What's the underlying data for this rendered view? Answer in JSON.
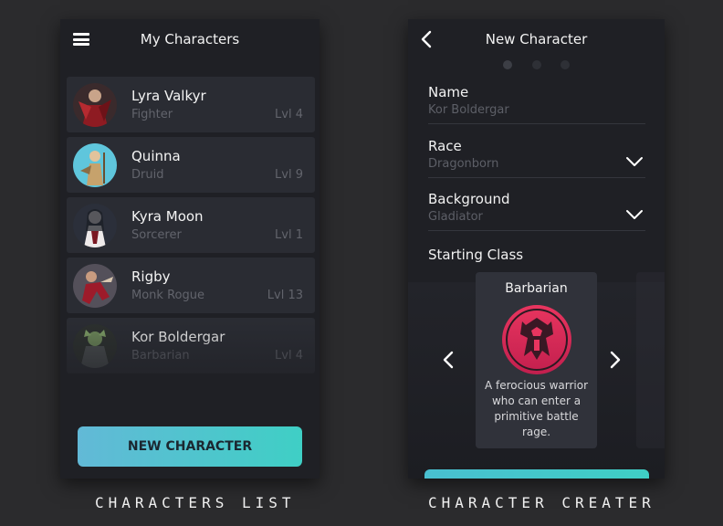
{
  "list_screen": {
    "title": "My Characters",
    "characters": [
      {
        "name": "Lyra Valkyr",
        "class": "Fighter",
        "level": "Lvl 4",
        "avatar": "portrait-warrior-red"
      },
      {
        "name": "Quinna",
        "class": "Druid",
        "level": "Lvl 9",
        "avatar": "portrait-druid-blue"
      },
      {
        "name": "Kyra Moon",
        "class": "Sorcerer",
        "level": "Lvl 1",
        "avatar": "portrait-sorcerer-dark"
      },
      {
        "name": "Rigby",
        "class": "Monk Rogue",
        "level": "Lvl 13",
        "avatar": "portrait-monk-red"
      },
      {
        "name": "Kor Boldergar",
        "class": "Barbarian",
        "level": "Lvl 4",
        "avatar": "portrait-barbarian-green"
      }
    ],
    "new_button": "NEW CHARACTER"
  },
  "create_screen": {
    "title": "New Character",
    "steps": 3,
    "current_step": 1,
    "fields": {
      "name_label": "Name",
      "name_value": "Kor Boldergar",
      "race_label": "Race",
      "race_value": "Dragonborn",
      "background_label": "Background",
      "background_value": "Gladiator"
    },
    "starting_class_label": "Starting Class",
    "class_card": {
      "title": "Barbarian",
      "description": "A ferocious warrior who can enter a primitive battle rage.",
      "emblem_color": "#e0305f"
    }
  },
  "captions": {
    "list": "CHARACTERS LIST",
    "create": "CHARACTER CREATER"
  },
  "colors": {
    "accent_start": "#62b9d7",
    "accent_end": "#3fcfc5",
    "background": "#2b2b2d",
    "panel": "#1f2025"
  }
}
